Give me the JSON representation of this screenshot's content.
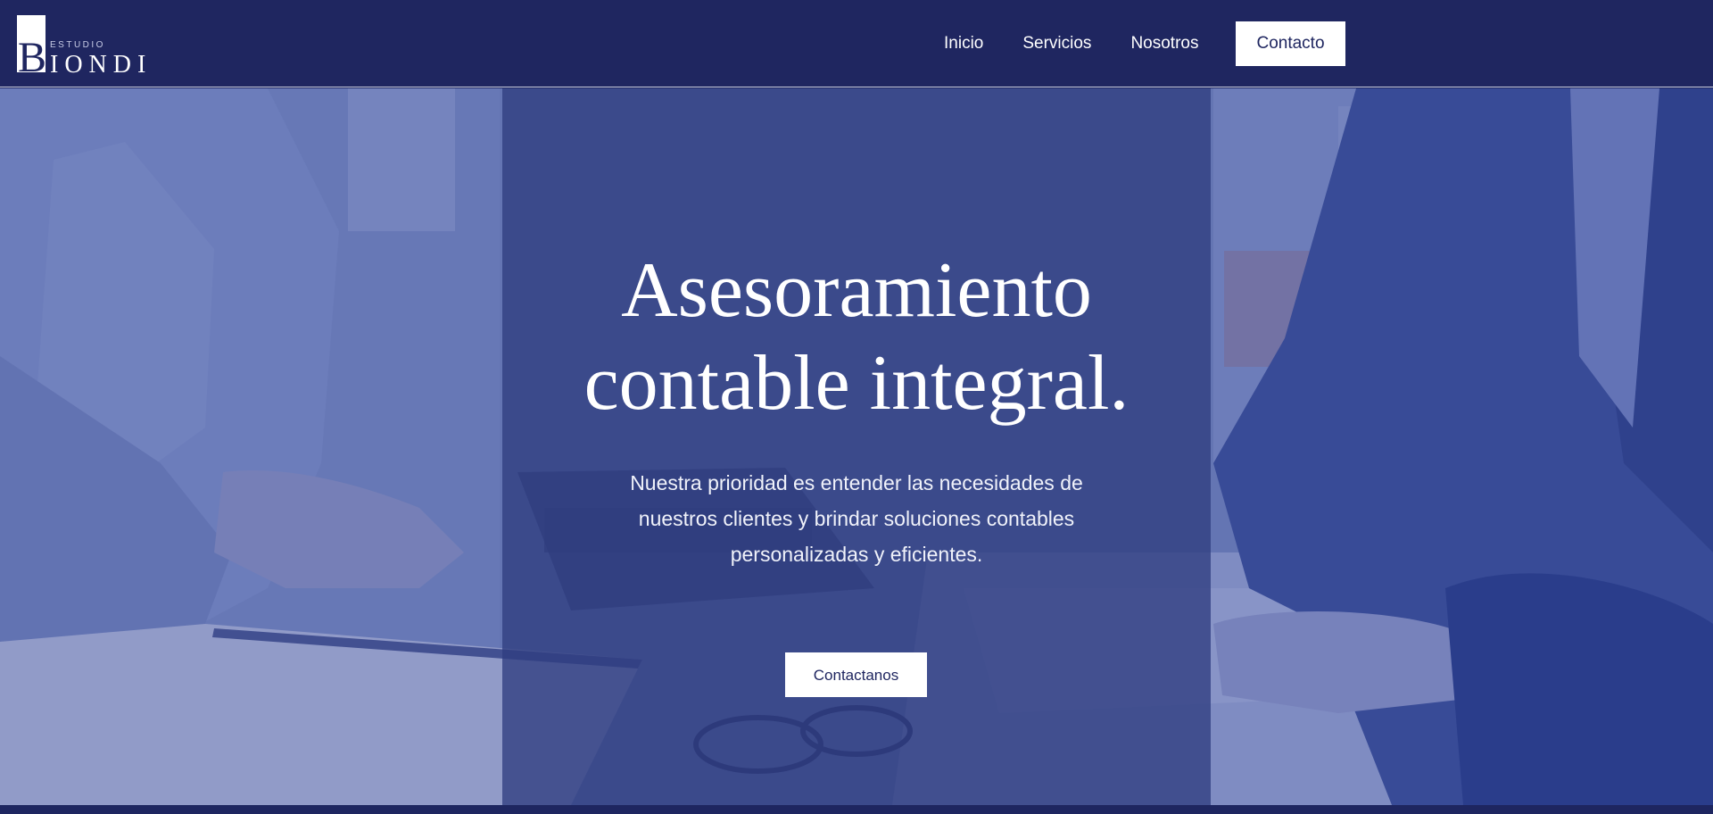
{
  "brand": {
    "logo_letter": "B",
    "logo_small": "ESTUDIO",
    "logo_big": "IONDI"
  },
  "nav": {
    "items": [
      {
        "label": "Inicio"
      },
      {
        "label": "Servicios"
      },
      {
        "label": "Nosotros"
      },
      {
        "label": "Contacto"
      }
    ]
  },
  "hero": {
    "title_line1": "Asesoramiento",
    "title_line2": "contable integral.",
    "text_line1": "Nuestra prioridad es entender las necesidades de",
    "text_line2": "nuestros clientes y brindar soluciones contables",
    "text_line3": "personalizadas y eficientes.",
    "cta_label": "Contactanos"
  },
  "colors": {
    "primary": "#1f2660",
    "overlay": "#303e80",
    "white": "#ffffff"
  }
}
